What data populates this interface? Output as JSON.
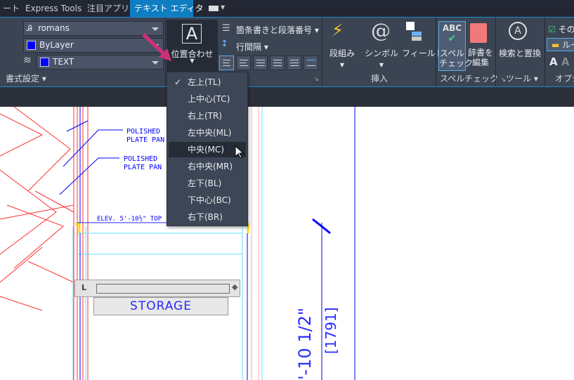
{
  "tabs": [
    {
      "label": "ート"
    },
    {
      "label": "Express Tools"
    },
    {
      "label": "注目アプリ"
    },
    {
      "label": "テキスト エディタ",
      "active": true
    }
  ],
  "format_panel": {
    "font": "romans",
    "color": "ByLayer",
    "layer": "TEXT",
    "footer": "書式設定"
  },
  "paragraph_panel": {
    "justify": "位置合わせ",
    "bullets": "箇条書きと段落番号",
    "line_spacing": "行間隔"
  },
  "insert_panel": {
    "columns": "段組み",
    "symbol": "シンボル",
    "field": "フィールド",
    "footer": "挿入"
  },
  "spell_panel": {
    "spellcheck_line1": "スペル",
    "spellcheck_line2": "チェック",
    "dict_line1": "辞書を",
    "dict_line2": "編集",
    "footer": "スペルチェック"
  },
  "tools_panel": {
    "find_replace": "検索と置換",
    "footer": "ツール"
  },
  "options_panel": {
    "more": "その",
    "ruler": "ルー",
    "footer": "オプシ"
  },
  "justify_menu": {
    "items": [
      {
        "label": "左上(TL)",
        "checked": true
      },
      {
        "label": "上中心(TC)"
      },
      {
        "label": "右上(TR)"
      },
      {
        "label": "左中央(ML)"
      },
      {
        "label": "中央(MC)",
        "hovered": true
      },
      {
        "label": "右中央(MR)"
      },
      {
        "label": "左下(BL)"
      },
      {
        "label": "下中心(BC)"
      },
      {
        "label": "右下(BR)"
      }
    ]
  },
  "drawing": {
    "note1_l1": "POLISHED",
    "note1_l2": "PLATE PAN",
    "note2_l1": "POLISHED",
    "note2_l2": "PLATE PAN",
    "elev": "ELEV. 5'-10½\" TOP",
    "text_editor_value": "STORAGE",
    "dim": "'-10 1/2\"",
    "dim_metric": "[1791]"
  },
  "colors": {
    "ribbon": "#3b4453",
    "accent": "#0f7dc2",
    "drawing_blue": "#0000ff",
    "drawing_red": "#ff0000"
  }
}
